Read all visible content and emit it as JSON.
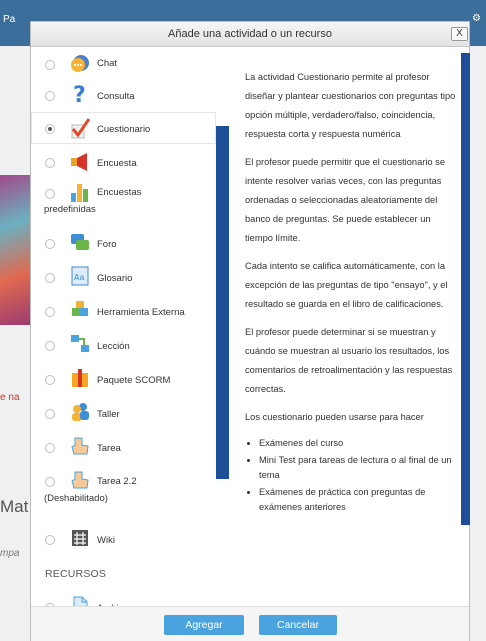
{
  "background": {
    "header_fragment": "Pa",
    "link_fragment": "e na",
    "heading_fragment": "Mat",
    "text_fragment": "mpa"
  },
  "dialog": {
    "title": "Añade una actividad o un recurso",
    "close_label": "X",
    "options": [
      {
        "label": "Chat",
        "icon": "chat-icon",
        "selected": false
      },
      {
        "label": "Consulta",
        "icon": "question-icon",
        "selected": false
      },
      {
        "label": "Cuestionario",
        "icon": "quiz-checkmark-icon",
        "selected": true
      },
      {
        "label": "Encuesta",
        "icon": "megaphone-icon",
        "selected": false
      },
      {
        "label": "Encuestas",
        "label_cont": "predefinidas",
        "icon": "bar-chart-icon",
        "selected": false
      },
      {
        "label": "Foro",
        "icon": "forum-icon",
        "selected": false
      },
      {
        "label": "Glosario",
        "icon": "glossary-icon",
        "selected": false
      },
      {
        "label": "Herramienta Externa",
        "icon": "puzzle-icon",
        "selected": false
      },
      {
        "label": "Lección",
        "icon": "lesson-icon",
        "selected": false
      },
      {
        "label": "Paquete SCORM",
        "icon": "scorm-package-icon",
        "selected": false
      },
      {
        "label": "Taller",
        "icon": "workshop-people-icon",
        "selected": false
      },
      {
        "label": "Tarea",
        "icon": "assignment-hand-icon",
        "selected": false
      },
      {
        "label": "Tarea 2.2",
        "label_cont": "(Deshabilitado)",
        "icon": "assignment-hand-icon",
        "selected": false
      },
      {
        "label": "Wiki",
        "icon": "wiki-icon",
        "selected": false
      }
    ],
    "resources_heading": "RECURSOS",
    "resources": [
      {
        "label": "Archivo",
        "icon": "file-icon",
        "selected": false
      }
    ],
    "description": {
      "paragraphs": [
        "La actividad Cuestionario permite al profesor diseñar y plantear cuestionarios con preguntas tipo opción múltiple, verdadero/falso, coincidencia, respuesta corta y respuesta numérica",
        "El profesor puede permitir que el cuestionario se intente resolver varias veces, con las preguntas ordenadas o seleccionadas aleatoriamente del banco de preguntas. Se puede establecer un tiempo límite.",
        "Cada intento se califica automáticamente, con la excepción de las preguntas de tipo \"ensayo\", y el resultado se guarda en el libro de calificaciones.",
        "El profesor puede determinar si se muestran y cuándo se muestran al usuario los resultados, los comentarios de retroalimentación y las respuestas correctas.",
        "Los cuestionario pueden usarse para hacer"
      ],
      "bullets": [
        "Exámenes del curso",
        "Mini Test para tareas de lectura o al final de un tema",
        "Exámenes de práctica con preguntas de exámenes anteriores"
      ]
    },
    "buttons": {
      "add": "Agregar",
      "cancel": "Cancelar"
    }
  },
  "colors": {
    "header_bar": "#3b6e9a",
    "scrollbar": "#1c4f98",
    "button": "#4aa3df"
  }
}
